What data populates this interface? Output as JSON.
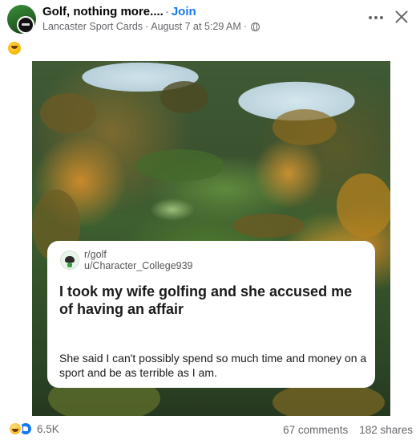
{
  "post": {
    "group_name": "Golf, nothing more....",
    "separator": "·",
    "join_label": "Join",
    "author": "Lancaster Sport Cards",
    "date": "August 7 at 5:29 AM",
    "meta_separator": "·",
    "privacy_icon": "globe-icon",
    "post_text_emoji": "grinning-face-icon"
  },
  "card": {
    "subreddit": "r/golf",
    "username": "u/Character_College939",
    "title": "I took my wife golfing and she accused me of having an affair",
    "body": "She said I can't possibly spend so much time and money on a sport and be as terrible as I am."
  },
  "footer": {
    "reaction_icons": [
      "haha-reaction-icon",
      "like-reaction-icon"
    ],
    "reaction_count": "6.5K",
    "comments": "67 comments",
    "shares": "182 shares"
  },
  "colors": {
    "link_blue": "#1877f2",
    "meta_gray": "#65676b"
  }
}
